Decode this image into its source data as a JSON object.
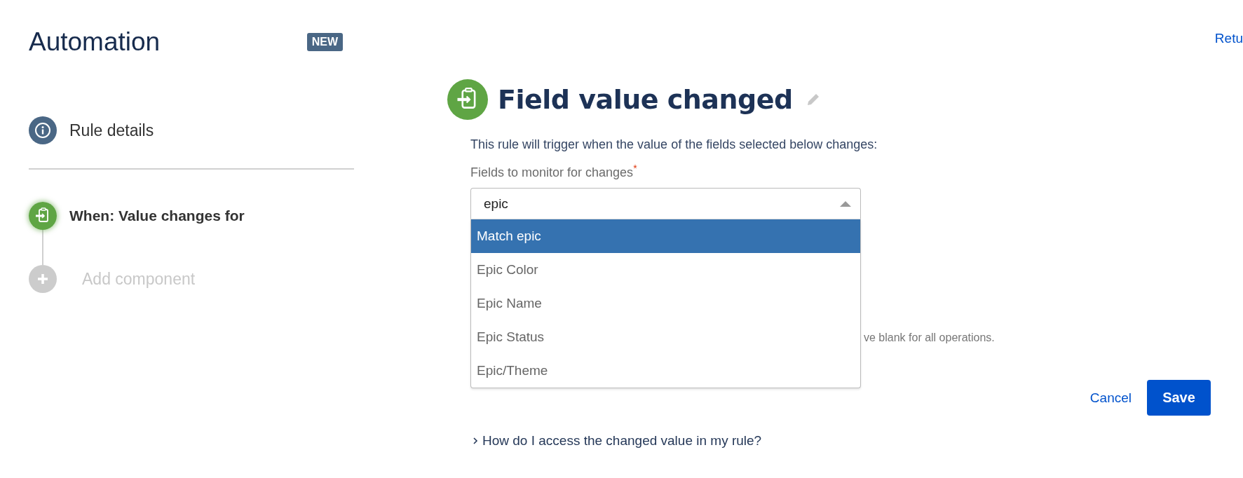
{
  "app": {
    "title": "Automation",
    "badge": "NEW",
    "return_link": "Retu"
  },
  "sidebar": {
    "items": [
      {
        "kind": "info",
        "label": "Rule details",
        "selected": false
      },
      {
        "kind": "trigger",
        "label": "When: Value changes for",
        "selected": true
      },
      {
        "kind": "add",
        "label": "Add component",
        "selected": false
      }
    ]
  },
  "trigger": {
    "title": "Field value changed",
    "description": "This rule will trigger when the value of the fields selected below changes:",
    "field_label": "Fields to monitor for changes",
    "required_mark": "*",
    "select": {
      "value": "epic",
      "expanded": true,
      "options": [
        {
          "label": "Match epic",
          "selected": true
        },
        {
          "label": "Epic Color",
          "selected": false
        },
        {
          "label": "Epic Name",
          "selected": false
        },
        {
          "label": "Epic Status",
          "selected": false
        },
        {
          "label": "Epic/Theme",
          "selected": false
        }
      ]
    },
    "helper_text": "ve blank for all operations.",
    "buttons": [
      {
        "kind": "link",
        "label": "Cancel"
      },
      {
        "kind": "primary",
        "label": "Save"
      }
    ],
    "help_link": {
      "label": "How do I access the changed value in my rule?"
    }
  }
}
